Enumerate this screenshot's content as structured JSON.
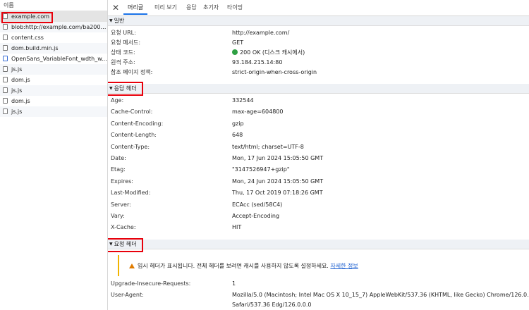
{
  "left_panel": {
    "column_header": "이름",
    "requests": [
      {
        "name": "example.com",
        "icon": "document-icon"
      },
      {
        "name": "blob:http://example.com/ba2003...",
        "icon": "script-icon"
      },
      {
        "name": "content.css",
        "icon": "file-icon"
      },
      {
        "name": "dom.build.min.js",
        "icon": "script-icon"
      },
      {
        "name": "OpenSans_VariableFont_wdth_w...",
        "icon": "font-icon"
      },
      {
        "name": "js.js",
        "icon": "script-icon"
      },
      {
        "name": "dom.js",
        "icon": "script-icon"
      },
      {
        "name": "js.js",
        "icon": "script-icon"
      },
      {
        "name": "dom.js",
        "icon": "script-icon"
      },
      {
        "name": "js.js",
        "icon": "script-icon"
      }
    ]
  },
  "tabs": [
    "머리글",
    "미리 보기",
    "응답",
    "초기자",
    "타이밍"
  ],
  "active_tab": "머리글",
  "general": {
    "title": "일반",
    "rows": [
      {
        "key": "요청 URL:",
        "value": "http://example.com/"
      },
      {
        "key": "요청 메서드:",
        "value": "GET"
      },
      {
        "key": "상태 코드:",
        "value": "200 OK (디스크 캐시에서)"
      },
      {
        "key": "원격 주소:",
        "value": "93.184.215.14:80"
      },
      {
        "key": "참조 페이지 정책:",
        "value": "strict-origin-when-cross-origin"
      }
    ]
  },
  "response_headers": {
    "title": "응답 헤더",
    "rows": [
      {
        "key": "Age:",
        "value": "332544"
      },
      {
        "key": "Cache-Control:",
        "value": "max-age=604800"
      },
      {
        "key": "Content-Encoding:",
        "value": "gzip"
      },
      {
        "key": "Content-Length:",
        "value": "648"
      },
      {
        "key": "Content-Type:",
        "value": "text/html; charset=UTF-8"
      },
      {
        "key": "Date:",
        "value": "Mon, 17 Jun 2024 15:05:50 GMT"
      },
      {
        "key": "Etag:",
        "value": "\"3147526947+gzip\""
      },
      {
        "key": "Expires:",
        "value": "Mon, 24 Jun 2024 15:05:50 GMT"
      },
      {
        "key": "Last-Modified:",
        "value": "Thu, 17 Oct 2019 07:18:26 GMT"
      },
      {
        "key": "Server:",
        "value": "ECAcc (sed/58C4)"
      },
      {
        "key": "Vary:",
        "value": "Accept-Encoding"
      },
      {
        "key": "X-Cache:",
        "value": "HIT"
      }
    ]
  },
  "request_headers": {
    "title": "요청 헤더",
    "warning": "임시 헤더가 표시됩니다. 전체 헤더를 보려면 캐시를 사용하지 않도록 설정하세요.",
    "warning_link": "자세한 정보",
    "rows": [
      {
        "key": "Upgrade-Insecure-Requests:",
        "value": "1"
      },
      {
        "key": "User-Agent:",
        "value": "Mozilla/5.0 (Macintosh; Intel Mac OS X 10_15_7) AppleWebKit/537.36 (KHTML, like Gecko) Chrome/126.0.0.0"
      }
    ],
    "user_agent_line2": "Safari/537.36 Edg/126.0.0.0"
  },
  "colors": {
    "highlight": "#e8000b",
    "status_ok": "#2ea043",
    "warning": "#e07b00",
    "link": "#1a5ed0"
  }
}
